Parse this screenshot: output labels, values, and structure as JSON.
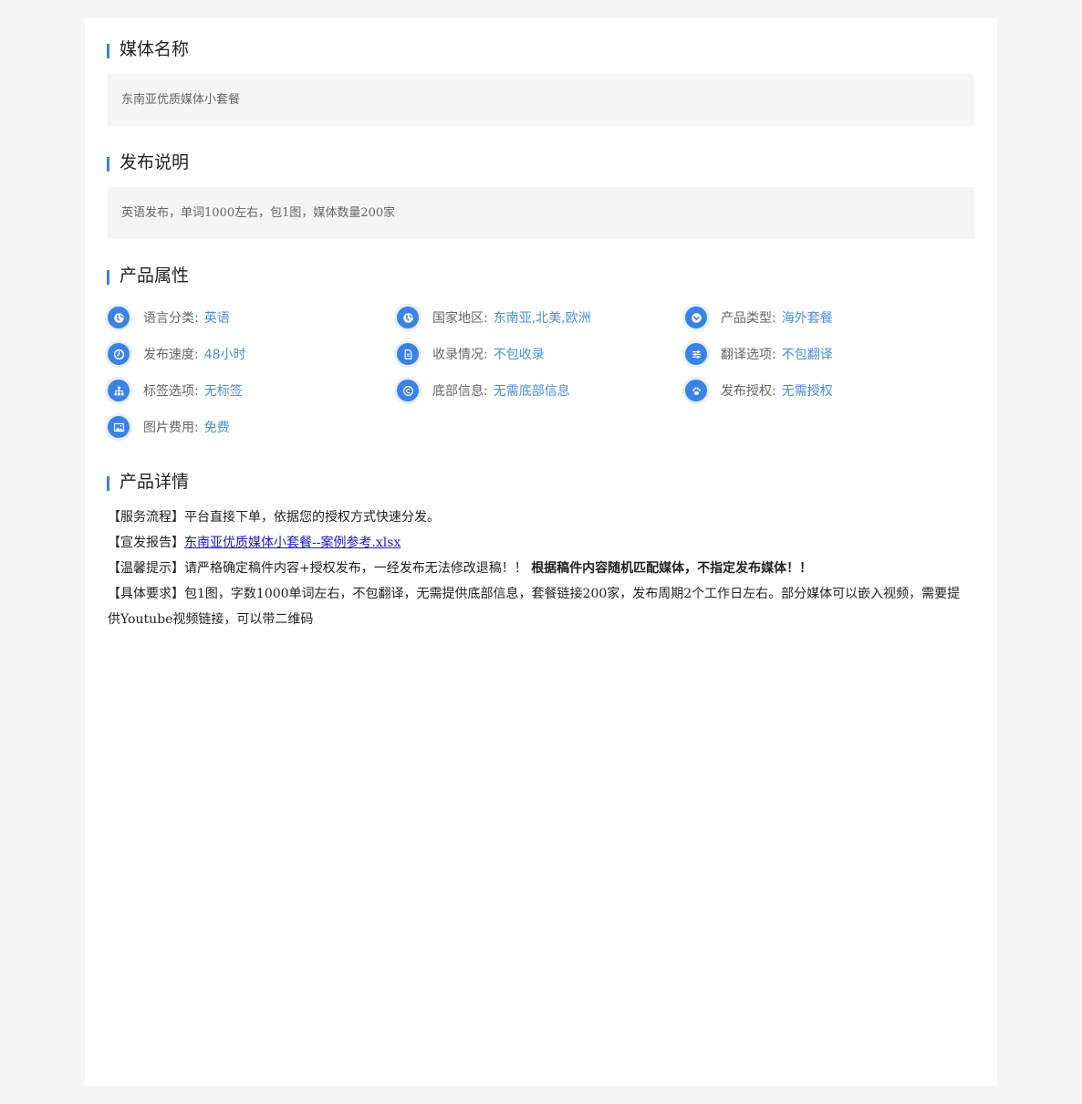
{
  "sections": {
    "media_name": {
      "title": "媒体名称",
      "value": "东南亚优质媒体小套餐"
    },
    "publish_note": {
      "title": "发布说明",
      "value": "英语发布，单词1000左右，包1图，媒体数量200家"
    },
    "attributes": {
      "title": "产品属性",
      "items": [
        {
          "label": "语言分类:",
          "value": "英语",
          "icon": "globe-icon"
        },
        {
          "label": "国家地区:",
          "value": "东南亚,北美,欧洲",
          "icon": "globe-icon"
        },
        {
          "label": "产品类型:",
          "value": "海外套餐",
          "icon": "chevron-down-icon"
        },
        {
          "label": "发布速度:",
          "value": "48小时",
          "icon": "clock-icon"
        },
        {
          "label": "收录情况:",
          "value": "不包收录",
          "icon": "document-icon"
        },
        {
          "label": "翻译选项:",
          "value": "不包翻译",
          "icon": "sliders-icon"
        },
        {
          "label": "标签选项:",
          "value": "无标签",
          "icon": "sitemap-icon"
        },
        {
          "label": "底部信息:",
          "value": "无需底部信息",
          "icon": "copyright-icon"
        },
        {
          "label": "发布授权:",
          "value": "无需授权",
          "icon": "paw-icon"
        },
        {
          "label": "图片费用:",
          "value": "免费",
          "icon": "image-icon"
        }
      ]
    },
    "details": {
      "title": "产品详情",
      "service_flow": {
        "tag": "【服务流程】",
        "text": "平台直接下单，依据您的授权方式快速分发。"
      },
      "report": {
        "tag": "【宣发报告】",
        "link": "东南亚优质媒体小套餐--案例参考.xlsx"
      },
      "tips": {
        "tag": "【温馨提示】",
        "text": "请严格确定稿件内容+授权发布，一经发布无法修改退稿！！",
        "bold": "根据稿件内容随机匹配媒体，不指定发布媒体！！"
      },
      "requirements": {
        "tag": "【具体要求】",
        "text": "包1图，字数1000单词左右，不包翻译，无需提供底部信息，套餐链接200家，发布周期2个工作日左右。部分媒体可以嵌入视频，需要提供Youtube视频链接，可以带二维码"
      }
    }
  },
  "colors": {
    "accent": "#3b82e6",
    "value_text": "#4a8fde",
    "field_bg": "#f5f5f5",
    "page_bg": "#f5f5f5"
  }
}
